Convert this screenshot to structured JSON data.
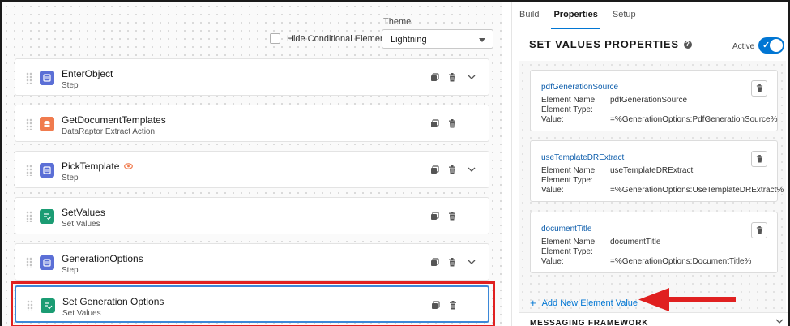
{
  "canvas": {
    "theme_label": "Theme",
    "hide_conditional_label": "Hide Conditional Elements",
    "theme_value": "Lightning",
    "steps": [
      {
        "title": "EnterObject",
        "subtitle": "Step",
        "icon": "step-icon",
        "color": "#5b6fd6",
        "has_chevron": true
      },
      {
        "title": "GetDocumentTemplates",
        "subtitle": "DataRaptor Extract Action",
        "icon": "dataraptor-icon",
        "color": "#f07b4e",
        "has_chevron": false
      },
      {
        "title": "PickTemplate",
        "subtitle": "Step",
        "icon": "step-icon",
        "color": "#5b6fd6",
        "has_chevron": true,
        "badge_icon": "eye-icon"
      },
      {
        "title": "SetValues",
        "subtitle": "Set Values",
        "icon": "set-values-icon",
        "color": "#1b9c73",
        "has_chevron": false
      },
      {
        "title": "GenerationOptions",
        "subtitle": "Step",
        "icon": "step-icon",
        "color": "#5b6fd6",
        "has_chevron": true
      },
      {
        "title": "Set Generation Options",
        "subtitle": "Set Values",
        "icon": "set-values-icon",
        "color": "#1b9c73",
        "has_chevron": false,
        "selected": true
      }
    ]
  },
  "panel": {
    "tabs": [
      {
        "label": "Build",
        "active": false
      },
      {
        "label": "Properties",
        "active": true
      },
      {
        "label": "Setup",
        "active": false
      }
    ],
    "title": "SET VALUES PROPERTIES",
    "active_label": "Active",
    "active_toggle": true,
    "element_name_label": "Element Name:",
    "element_type_label": "Element Type:",
    "value_label": "Value:",
    "elements": [
      {
        "name": "pdfGenerationSource",
        "element_name": "pdfGenerationSource",
        "element_type": "",
        "value": "=%GenerationOptions:PdfGenerationSource%"
      },
      {
        "name": "useTemplateDRExtract",
        "element_name": "useTemplateDRExtract",
        "element_type": "",
        "value": "=%GenerationOptions:UseTemplateDRExtract%"
      },
      {
        "name": "documentTitle",
        "element_name": "documentTitle",
        "element_type": "",
        "value": "=%GenerationOptions:DocumentTitle%"
      }
    ],
    "add_link_label": "Add New Element Value",
    "messaging_label": "MESSAGING FRAMEWORK"
  },
  "colors": {
    "brand_blue": "#0176d3",
    "annotation_red": "#e02020",
    "step_blue": "#5b6fd6",
    "dataraptor_orange": "#f07b4e",
    "set_values_green": "#1b9c73"
  }
}
